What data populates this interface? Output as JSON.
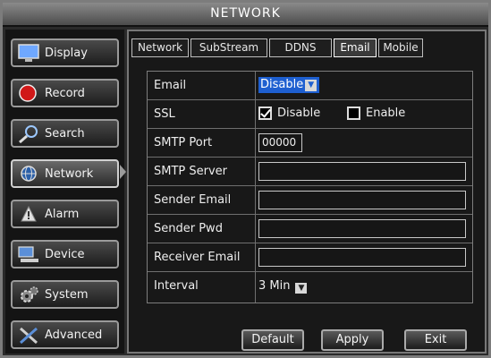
{
  "window": {
    "title": "NETWORK"
  },
  "sidebar": {
    "items": [
      {
        "label": "Display",
        "icon": "monitor-icon"
      },
      {
        "label": "Record",
        "icon": "record-icon"
      },
      {
        "label": "Search",
        "icon": "search-icon"
      },
      {
        "label": "Network",
        "icon": "network-icon",
        "active": true
      },
      {
        "label": "Alarm",
        "icon": "alarm-icon"
      },
      {
        "label": "Device",
        "icon": "device-icon"
      },
      {
        "label": "System",
        "icon": "system-icon"
      },
      {
        "label": "Advanced",
        "icon": "advanced-icon"
      }
    ]
  },
  "tabs": [
    {
      "label": "Network"
    },
    {
      "label": "SubStream"
    },
    {
      "label": "DDNS"
    },
    {
      "label": "Email",
      "active": true
    },
    {
      "label": "Mobile"
    }
  ],
  "form": {
    "email": {
      "label": "Email",
      "value": "Disable"
    },
    "ssl": {
      "label": "SSL",
      "option_disable": "Disable",
      "option_enable": "Enable",
      "checked": "Disable"
    },
    "smtp_port": {
      "label": "SMTP Port",
      "value": "00000"
    },
    "smtp_server": {
      "label": "SMTP Server",
      "value": ""
    },
    "sender_email": {
      "label": "Sender Email",
      "value": ""
    },
    "sender_pwd": {
      "label": "Sender Pwd",
      "value": ""
    },
    "receiver_email": {
      "label": "Receiver Email",
      "value": ""
    },
    "interval": {
      "label": "Interval",
      "value": "3 Min"
    }
  },
  "buttons": {
    "default_label": "Default",
    "apply_label": "Apply",
    "exit_label": "Exit"
  },
  "colors": {
    "accent_blue": "#1e5fd0",
    "record_red": "#d01818",
    "panel_bg": "#181818"
  }
}
